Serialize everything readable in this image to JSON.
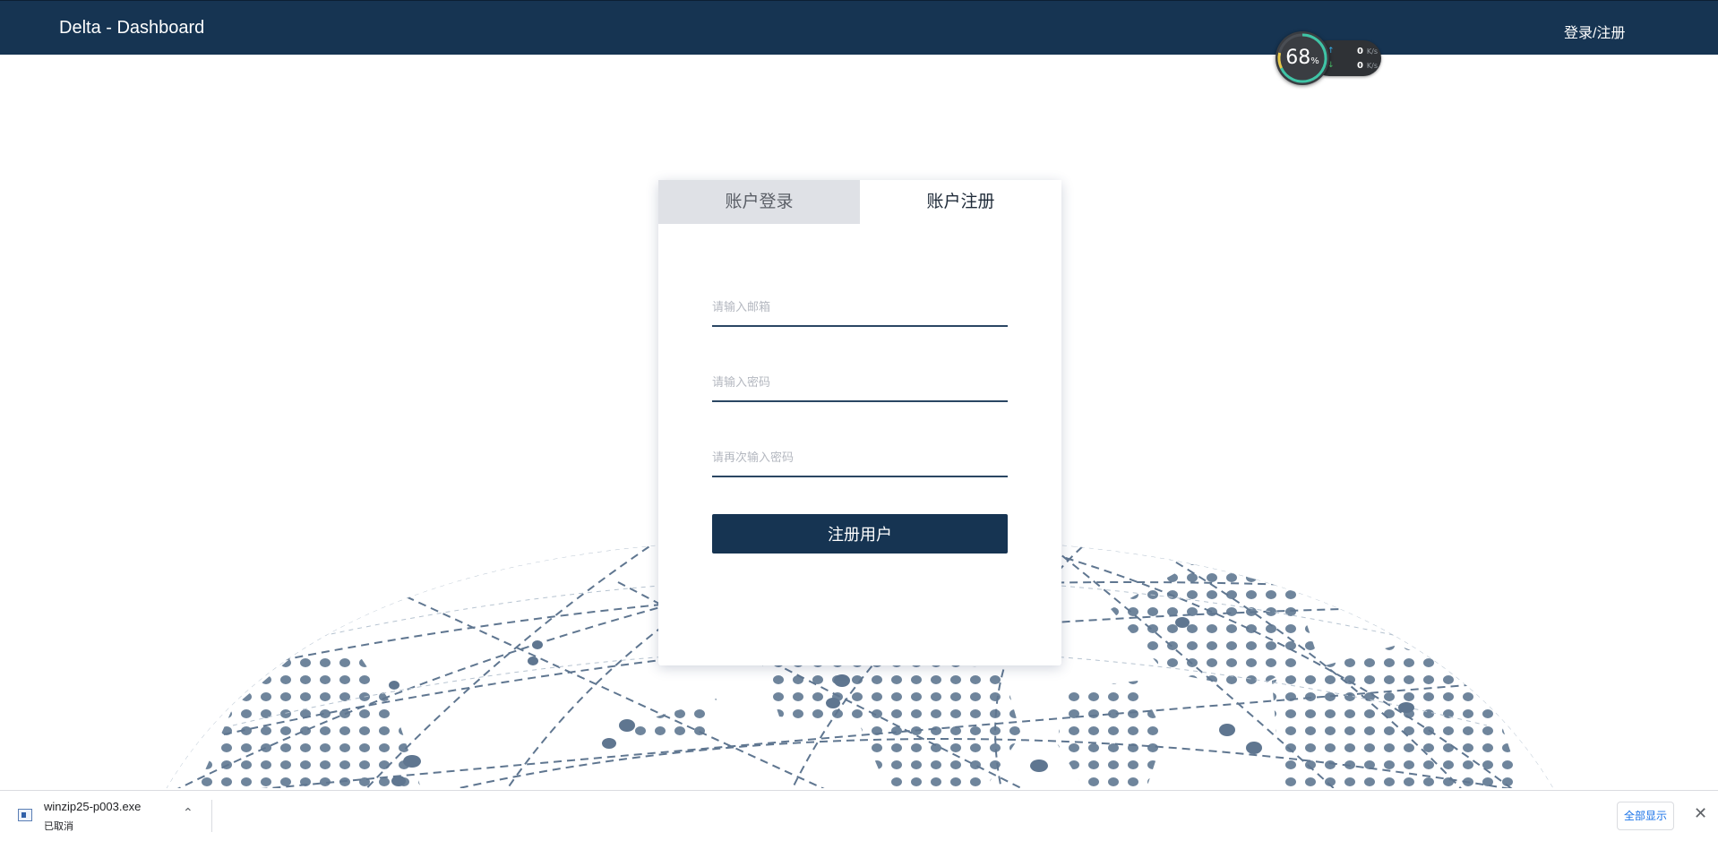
{
  "navbar": {
    "brand": "Delta - Dashboard",
    "auth_link": "登录/注册"
  },
  "speed_widget": {
    "percent": "68",
    "percent_unit": "%",
    "upload": {
      "value": "0",
      "unit": "K/s"
    },
    "download": {
      "value": "0",
      "unit": "K/s"
    }
  },
  "auth_card": {
    "tabs": [
      {
        "label": "账户登录",
        "active": false
      },
      {
        "label": "账户注册",
        "active": true
      }
    ],
    "fields": {
      "email_placeholder": "请输入邮箱",
      "password_placeholder": "请输入密码",
      "confirm_placeholder": "请再次输入密码"
    },
    "submit_label": "注册用户"
  },
  "download_bar": {
    "file_name": "winzip25-p003.exe",
    "status": "已取消",
    "show_all_label": "全部显示"
  },
  "colors": {
    "brand": "#163452",
    "globe": "#6f859c",
    "tab_inactive": "#dfe1e6"
  }
}
